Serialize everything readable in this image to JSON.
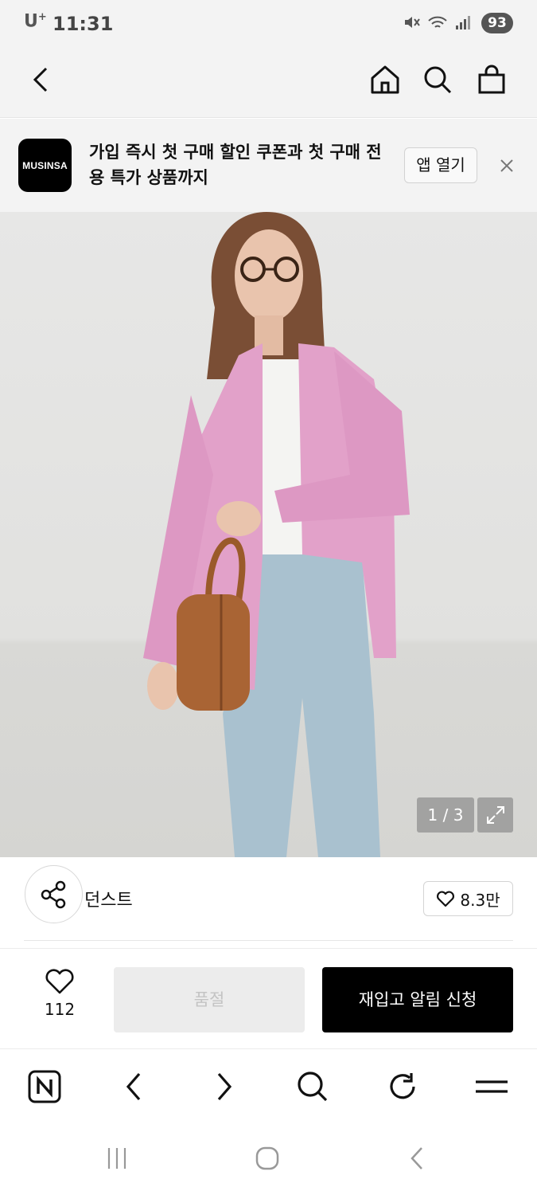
{
  "status_bar": {
    "carrier": "U",
    "carrier_sup": "+",
    "time": "11:31",
    "battery": "93"
  },
  "top_nav": {
    "icons": [
      "back-arrow-icon",
      "home-icon",
      "search-icon",
      "shopping-bag-icon"
    ]
  },
  "promo": {
    "logo_text": "MUSINSA",
    "message": "가입 즉시 첫 구매 할인 쿠폰과 첫 구매 전용 특가 상품까지",
    "open_app_label": "앱 열기"
  },
  "product_image": {
    "counter": "1 / 3"
  },
  "brand": {
    "name": "던스트",
    "likes": "8.3만"
  },
  "purchase_bar": {
    "wish_count": "112",
    "soldout_label": "품절",
    "restock_label": "재입고 알림 신청"
  },
  "browser_toolbar": {
    "icons": [
      "naver-icon",
      "back-icon",
      "forward-icon",
      "search-icon",
      "refresh-icon",
      "menu-icon"
    ]
  },
  "android_nav": {
    "icons": [
      "recent-apps-icon",
      "home-icon",
      "back-icon"
    ]
  },
  "colors": {
    "background": "#f3f3f3",
    "primary_button": "#000000",
    "disabled_button": "#ececec",
    "shirt": "#e2a1c9",
    "jeans": "#a9c1cf"
  }
}
